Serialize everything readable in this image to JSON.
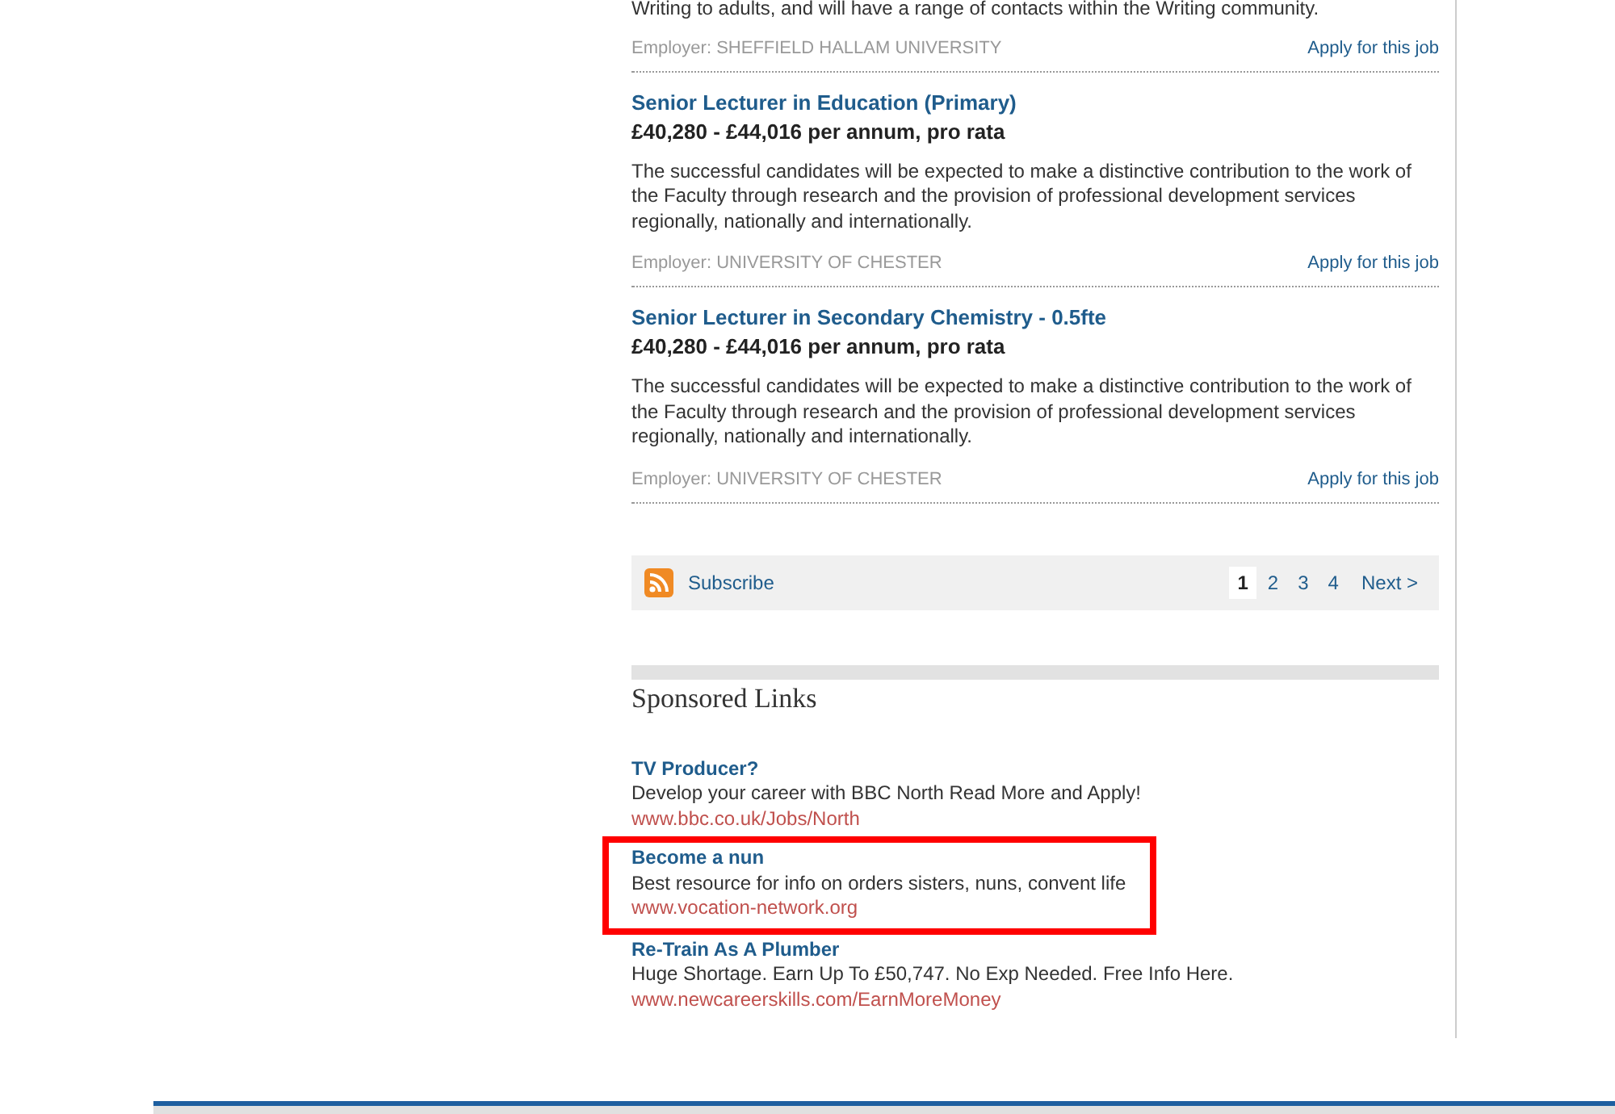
{
  "jobs": [
    {
      "description": "Writing to adults, and will have a range of contacts within the Writing community.",
      "employer": "Employer: SHEFFIELD HALLAM UNIVERSITY",
      "apply": "Apply for this job"
    },
    {
      "title": "Senior Lecturer in Education (Primary)",
      "salary": "£40,280 - £44,016 per annum, pro rata",
      "description": "The successful candidates will be expected to make a distinctive contribution to the work of the Faculty through research and the provision of professional development services regionally, nationally and internationally.",
      "employer": "Employer: UNIVERSITY OF CHESTER",
      "apply": "Apply for this job"
    },
    {
      "title": "Senior Lecturer in Secondary Chemistry - 0.5fte",
      "salary": "£40,280 - £44,016 per annum, pro rata",
      "description": "The successful candidates will be expected to make a distinctive contribution to the work of the Faculty through research and the provision of professional development services regionally, nationally and internationally.",
      "employer": "Employer: UNIVERSITY OF CHESTER",
      "apply": "Apply for this job"
    }
  ],
  "pager": {
    "subscribe": "Subscribe",
    "pages": [
      {
        "label": "1",
        "selected": true
      },
      {
        "label": "2",
        "selected": false
      },
      {
        "label": "3",
        "selected": false
      },
      {
        "label": "4",
        "selected": false
      }
    ],
    "next": "Next >"
  },
  "sponsored": {
    "heading": "Sponsored Links",
    "ads": [
      {
        "title": "TV Producer?",
        "text": "Develop your career with BBC North Read More and Apply!",
        "url": "www.bbc.co.uk/Jobs/North",
        "highlighted": false
      },
      {
        "title": "Become a nun",
        "text": "Best resource for info on orders sisters, nuns, convent life",
        "url": "www.vocation-network.org",
        "highlighted": true
      },
      {
        "title": "Re-Train As A Plumber",
        "text": "Huge Shortage. Earn Up To £50,747. No Exp Needed. Free Info Here.",
        "url": "www.newcareerskills.com/EarnMoreMoney",
        "highlighted": false
      }
    ]
  }
}
